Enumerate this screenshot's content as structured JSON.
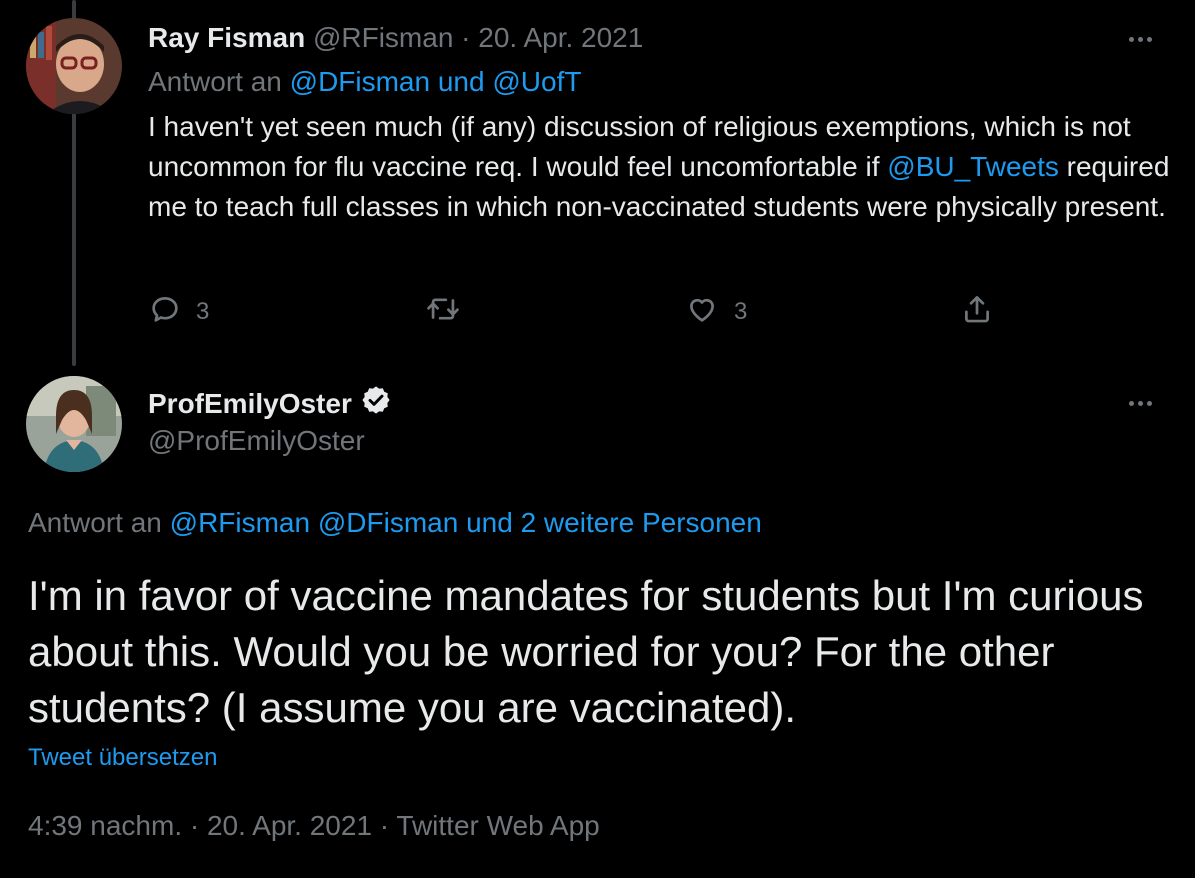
{
  "tweet1": {
    "author_name": "Ray Fisman",
    "handle": "@RFisman",
    "separator": " · ",
    "date": "20. Apr. 2021",
    "reply_prefix": "Antwort an ",
    "reply_user1": "@DFisman",
    "reply_conj": " und ",
    "reply_user2": "@UofT",
    "text_part1": "I haven't yet seen much (if any) discussion of religious exemptions, which is not uncommon for flu vaccine req. I would feel uncomfortable if ",
    "mention": "@BU_Tweets",
    "text_part2": " required me to teach full classes in which non-vaccinated students were physically present.",
    "reply_count": "3",
    "like_count": "3"
  },
  "tweet2": {
    "author_name": "ProfEmilyOster",
    "handle": "@ProfEmilyOster",
    "reply_prefix": "Antwort an ",
    "reply_user1": "@RFisman",
    "reply_sep": " ",
    "reply_rest": "@DFisman und 2 weitere Personen",
    "text": "I'm in favor of vaccine mandates for students but I'm curious about this. Would you be worried for you? For the other students?  (I assume you are vaccinated).",
    "translate_label": "Tweet übersetzen",
    "meta": "4:39 nachm. · 20. Apr. 2021 · Twitter Web App"
  },
  "colors": {
    "background": "#000000",
    "text": "#e7e9ea",
    "muted": "#71767b",
    "link": "#1d9bf0",
    "thread_line": "#3a3d40"
  },
  "icons": {
    "reply": "reply-icon",
    "retweet": "retweet-icon",
    "like": "heart-icon",
    "share": "share-icon",
    "verified": "verified-badge-icon",
    "more": "more-icon"
  }
}
